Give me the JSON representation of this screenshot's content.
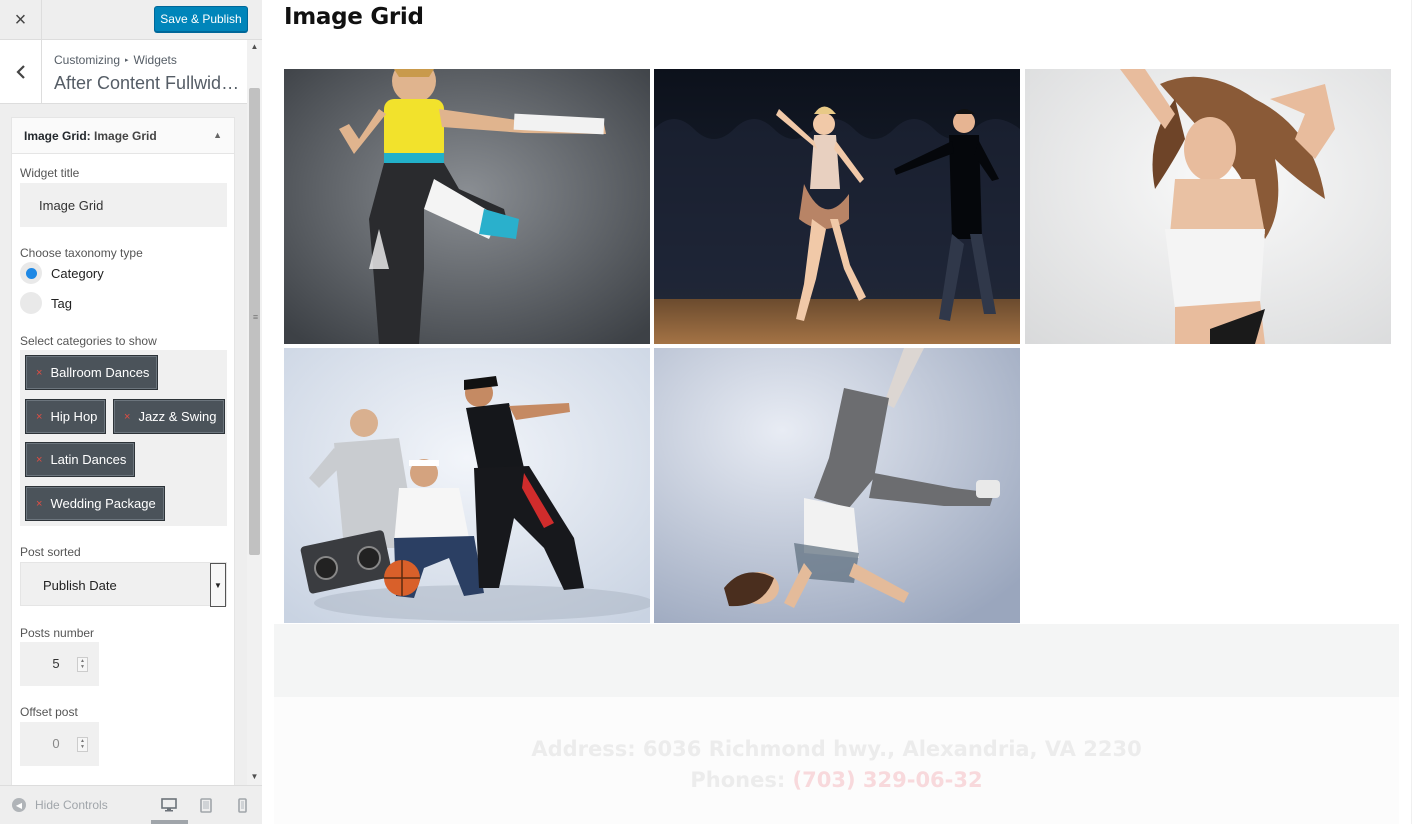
{
  "app": {
    "close_label": "×",
    "publish_label": "Save & Publish",
    "breadcrumb": {
      "root": "Customizing",
      "separator": "▸",
      "current": "Widgets"
    },
    "section_title": "After Content Fullwidt..."
  },
  "widget": {
    "head_bold": "Image Grid:",
    "head_name": " Image Grid",
    "toggle_icon": "▲",
    "title_label": "Widget title",
    "title_value": "Image Grid",
    "taxonomy_label": "Choose taxonomy type",
    "taxonomy_options": [
      {
        "label": "Category",
        "selected": true
      },
      {
        "label": "Tag",
        "selected": false
      }
    ],
    "categories_label": "Select categories to show",
    "categories": [
      {
        "label": "Ballroom Dances"
      },
      {
        "label": "Hip Hop"
      },
      {
        "label": "Jazz & Swing"
      },
      {
        "label": "Latin Dances"
      },
      {
        "label": "Wedding Package"
      }
    ],
    "remove_glyph": "×",
    "sort_label": "Post sorted",
    "sort_value": "Publish Date",
    "posts_number_label": "Posts number",
    "posts_number_value": "5",
    "offset_label": "Offset post",
    "offset_value": "0"
  },
  "footer_bar": {
    "hide_label": "Hide Controls",
    "devices": [
      "desktop-icon",
      "tablet-icon",
      "mobile-icon"
    ],
    "active_device": "desktop"
  },
  "preview": {
    "title": "Image Grid",
    "address": "Address: 6036 Richmond hwy., Alexandria, VA 2230",
    "phones_label": "Phones:",
    "phones_value": "(703) 329-06-32"
  },
  "colors": {
    "publish": "#0085ba",
    "chip": "#4b535a",
    "radio_on": "#1e88e5",
    "remove_x": "#e14d43"
  }
}
